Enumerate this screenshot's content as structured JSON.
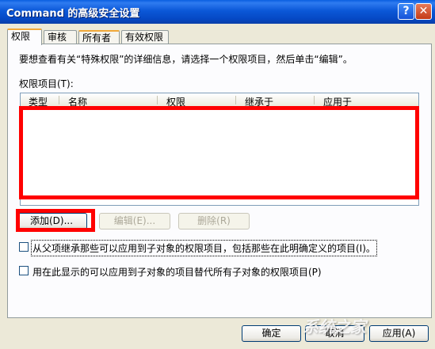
{
  "window": {
    "title": "Command 的高级安全设置",
    "help_glyph": "?",
    "close_glyph": "✕"
  },
  "tabs": [
    {
      "label": "权限"
    },
    {
      "label": "审核"
    },
    {
      "label": "所有者"
    },
    {
      "label": "有效权限"
    }
  ],
  "instruction": "要想查看有关“特殊权限”的详细信息，请选择一个权限项目，然后单击“编辑”。",
  "permissions_label": "权限项目(T):",
  "columns": [
    "类型",
    "名称",
    "权限",
    "继承于",
    "应用于"
  ],
  "buttons": {
    "add": "添加(D)...",
    "edit": "编辑(E)...",
    "delete": "删除(R)",
    "ok": "确定",
    "cancel": "取消",
    "apply": "应用(A)"
  },
  "options": {
    "inherit": "从父项继承那些可以应用到子对象的权限项目，包括那些在此明确定义的项目(I)。",
    "replace": "用在此显示的可以应用到子对象的项目替代所有子对象的权限项目(P)"
  },
  "watermark": "系统之家",
  "colors": {
    "highlight": "#ff0000",
    "titlebar": "#0b58d8"
  }
}
